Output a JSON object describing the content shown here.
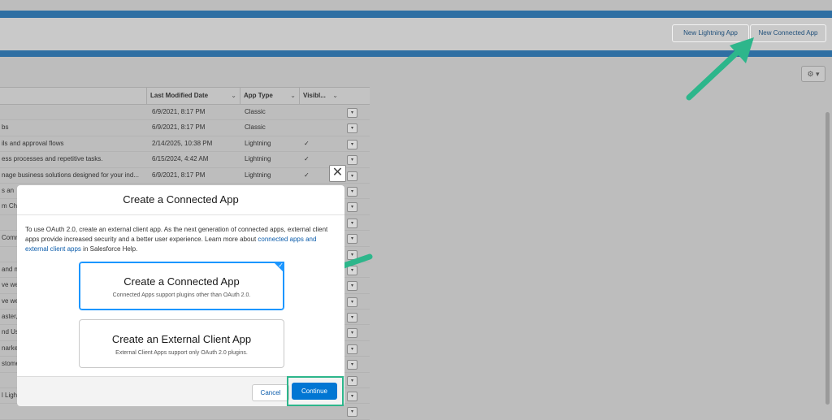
{
  "header": {
    "new_lightning_app": "New Lightning App",
    "new_connected_app": "New Connected App"
  },
  "table": {
    "columns": [
      "Last Modified Date",
      "App Type",
      "Visibl..."
    ],
    "rows": [
      {
        "desc": "",
        "date": "6/9/2021, 8:17 PM",
        "type": "Classic",
        "visible": false
      },
      {
        "desc": "bs",
        "date": "6/9/2021, 8:17 PM",
        "type": "Classic",
        "visible": false
      },
      {
        "desc": "ils and approval flows",
        "date": "2/14/2025, 10:38 PM",
        "type": "Lightning",
        "visible": true
      },
      {
        "desc": "ess processes and repetitive tasks.",
        "date": "6/15/2024, 4:42 AM",
        "type": "Lightning",
        "visible": true
      },
      {
        "desc": "nage business solutions designed for your ind...",
        "date": "6/9/2021, 8:17 PM",
        "type": "Lightning",
        "visible": true
      },
      {
        "desc": "s an",
        "date": "",
        "type": "",
        "visible": false
      },
      {
        "desc": "m Ch",
        "date": "",
        "type": "",
        "visible": false
      },
      {
        "desc": "",
        "date": "",
        "type": "",
        "visible": false
      },
      {
        "desc": "Comm",
        "date": "",
        "type": "",
        "visible": false
      },
      {
        "desc": "",
        "date": "",
        "type": "",
        "visible": false
      },
      {
        "desc": "and m",
        "date": "",
        "type": "",
        "visible": false
      },
      {
        "desc": "ve wel",
        "date": "",
        "type": "",
        "visible": false
      },
      {
        "desc": "ve wel",
        "date": "",
        "type": "",
        "visible": false
      },
      {
        "desc": "aster, .",
        "date": "",
        "type": "",
        "visible": false
      },
      {
        "desc": "nd Us",
        "date": "",
        "type": "",
        "visible": false
      },
      {
        "desc": "narket",
        "date": "",
        "type": "",
        "visible": false
      },
      {
        "desc": "stome",
        "date": "",
        "type": "",
        "visible": false
      },
      {
        "desc": "",
        "date": "",
        "type": "",
        "visible": false
      },
      {
        "desc": "l Light",
        "date": "",
        "type": "",
        "visible": false
      },
      {
        "desc": "",
        "date": "",
        "type": "",
        "visible": false
      }
    ]
  },
  "modal": {
    "title": "Create a Connected App",
    "body_text_1": "To use OAuth 2.0, create an external client app. As the next generation of connected apps, external client apps provide increased security and a better user experience. Learn more about ",
    "body_link": "connected apps and external client apps",
    "body_text_2": " in Salesforce Help.",
    "option_connected": {
      "title": "Create a Connected App",
      "subtitle": "Connected Apps support plugins other than OAuth 2.0."
    },
    "option_external": {
      "title": "Create an External Client App",
      "subtitle": "External Client Apps support only OAuth 2.0 plugins."
    },
    "cancel_label": "Cancel",
    "continue_label": "Continue"
  },
  "annotation_color": "#2db68b",
  "icons": [
    "gear-icon",
    "close-icon",
    "checkmark-icon",
    "chevron-down-icon",
    "arrow-annotation-icon"
  ]
}
